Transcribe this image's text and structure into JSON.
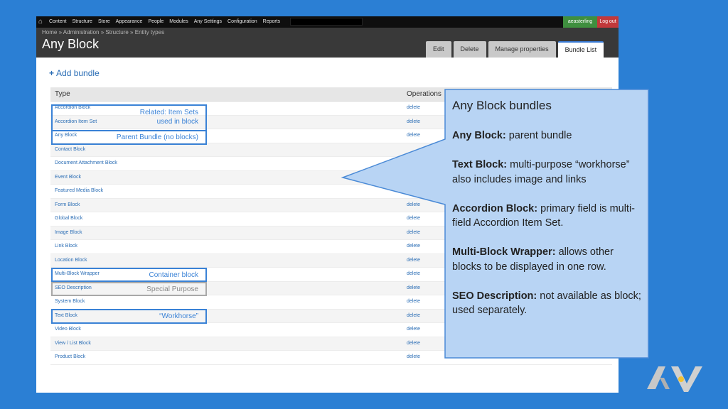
{
  "toolbar": {
    "home_icon": "home-icon",
    "menu": [
      "Content",
      "Structure",
      "Store",
      "Appearance",
      "People",
      "Modules",
      "Any Settings",
      "Configuration",
      "Reports"
    ],
    "user": "aeasterling",
    "logout": "Log out"
  },
  "header": {
    "breadcrumb": "Home » Administration » Structure » Entity types",
    "title": "Any Block",
    "tabs": [
      "Edit",
      "Delete",
      "Manage properties",
      "Bundle List"
    ],
    "active_tab": "Bundle List"
  },
  "content": {
    "add_bundle": "Add bundle",
    "add_icon": "plus-icon"
  },
  "table": {
    "headers": {
      "type": "Type",
      "operations": "Operations"
    },
    "rows": [
      {
        "name": "Accordion Block",
        "op": "delete"
      },
      {
        "name": "Accordion Item Set",
        "op": "delete"
      },
      {
        "name": "Any Block",
        "op": "delete"
      },
      {
        "name": "Contact Block",
        "op": ""
      },
      {
        "name": "Document Attachment Block",
        "op": ""
      },
      {
        "name": "Event Block",
        "op": ""
      },
      {
        "name": "Featured Media Block",
        "op": ""
      },
      {
        "name": "Form Block",
        "op": "delete"
      },
      {
        "name": "Global Block",
        "op": "delete"
      },
      {
        "name": "Image Block",
        "op": "delete"
      },
      {
        "name": "Link Block",
        "op": "delete"
      },
      {
        "name": "Location Block",
        "op": "delete"
      },
      {
        "name": "Multi-Block Wrapper",
        "op": "delete"
      },
      {
        "name": "SEO Description",
        "op": "delete"
      },
      {
        "name": "System Block",
        "op": "delete"
      },
      {
        "name": "Text Block",
        "op": "delete"
      },
      {
        "name": "Video Block",
        "op": "delete"
      },
      {
        "name": "View / List Block",
        "op": "delete"
      },
      {
        "name": "Product Block",
        "op": "delete"
      }
    ]
  },
  "annotations": {
    "related": "Related: Item Sets\nused in block",
    "parent": "Parent Bundle (no blocks)",
    "container": "Container block",
    "special": "Special Purpose",
    "workhorse": "“Workhorse”"
  },
  "callout": {
    "title": "Any Block bundles",
    "items": [
      {
        "term": "Any Block:",
        "text": " parent bundle"
      },
      {
        "term": "Text Block:",
        "text": " multi-purpose “workhorse” also includes image and links"
      },
      {
        "term": "Accordion Block:",
        "text": " primary field is multi-field Accordion Item Set."
      },
      {
        "term": "Multi-Block Wrapper:",
        "text": " allows other blocks to be displayed in one row."
      },
      {
        "term": "SEO Description:",
        "text": " not available as block; used separately."
      }
    ]
  },
  "logo": {
    "icon": "av-logo-icon"
  },
  "colors": {
    "background": "#2b7fd4",
    "callout_fill": "#b8d4f4",
    "annotation": "#3a82d6",
    "link": "#2a6db5",
    "user_button": "#3f8f3f",
    "logout_button": "#c2393b"
  }
}
